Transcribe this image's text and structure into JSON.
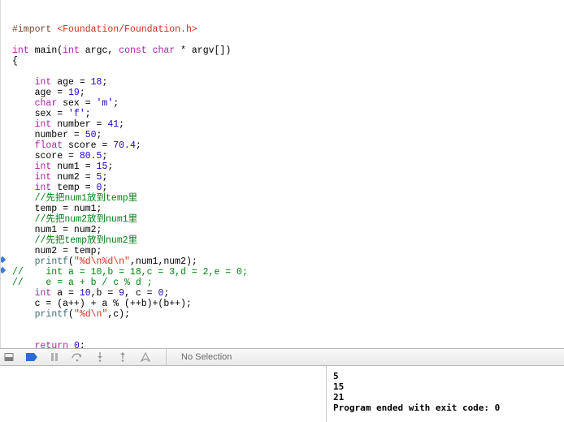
{
  "code": {
    "l1_import": "#import ",
    "l1_inc": "<Foundation/Foundation.h>",
    "l3_int": "int",
    "l3_main": " main(",
    "l3_int2": "int",
    "l3_argc": " argc, ",
    "l3_const": "const",
    "l3_sp": " ",
    "l3_char": "char",
    "l3_rest": " * argv[])",
    "l4": "{",
    "l6_int": "int",
    "l6_r": " age = ",
    "l6_n": "18",
    "l6_s": ";",
    "l7": "    age = ",
    "l7_n": "19",
    "l7_s": ";",
    "l8_char": "char",
    "l8_r": " sex = ",
    "l8_c": "'m'",
    "l8_s": ";",
    "l9": "    sex = ",
    "l9_c": "'f'",
    "l9_s": ";",
    "l10_int": "int",
    "l10_r": " number = ",
    "l10_n": "41",
    "l10_s": ";",
    "l11": "    number = ",
    "l11_n": "50",
    "l11_s": ";",
    "l12_float": "float",
    "l12_r": " score = ",
    "l12_n": "70.4",
    "l12_s": ";",
    "l13": "    score = ",
    "l13_n": "80.5",
    "l13_s": ";",
    "l14_int": "int",
    "l14_r": " num1 = ",
    "l14_n": "15",
    "l14_s": ";",
    "l15_int": "int",
    "l15_r": " num2 = ",
    "l15_n": "5",
    "l15_s": ";",
    "l16_int": "int",
    "l16_r": " temp = ",
    "l16_n": "0",
    "l16_s": ";",
    "l17": "    //先把num1放到temp里",
    "l18": "    temp = num1;",
    "l19": "    //先把num2放到num1里",
    "l20": "    num1 = num2;",
    "l21": "    //先把temp放到num2里",
    "l22": "    num2 = temp;",
    "l23_fn": "printf",
    "l23_p": "(",
    "l23_str": "\"%d\\n%d\\n\"",
    "l23_r": ",num1,num2);",
    "l24": "//    int a = 10,b = 18,c = 3,d = 2,e = 0;",
    "l25": "//    e = a + b / c % d ;",
    "l26_int": "int",
    "l26_a": " a = ",
    "l26_na": "10",
    "l26_b": ",b = ",
    "l26_nb": "9",
    "l26_c": ", c = ",
    "l26_nc": "0",
    "l26_s": ";",
    "l27": "    c = (a++) + a % (++b)+(b++);",
    "l28_fn": "printf",
    "l28_p": "(",
    "l28_str": "\"%d\\n\"",
    "l28_r": ",c);",
    "l31_ret": "return",
    "l31_sp": " ",
    "l31_n": "0",
    "l31_s": ";",
    "l32": "}"
  },
  "toolbar": {
    "selection": "No Selection"
  },
  "console": {
    "line1": "5",
    "line2": "15",
    "line3": "21",
    "line4": "Program ended with exit code: 0"
  }
}
